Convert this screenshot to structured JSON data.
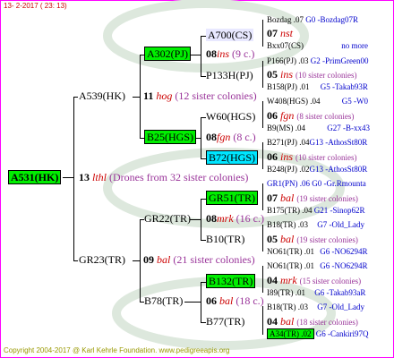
{
  "date": "13-  2-2017  ( 23: 13)",
  "footer": "Copyright 2004-2017 @ Karl Kehrle Foundation.   www.pedigreeapis.org",
  "root": {
    "id": "A531(HK)",
    "gen": "13",
    "mark": "lthl",
    "note": "(Drones from 32 sister colonies)"
  },
  "dam": {
    "id": "A539(HK)",
    "gen": "11",
    "mark": "hog",
    "note": "(12 sister colonies)"
  },
  "sire": {
    "id": "GR23(TR)",
    "gen": "09",
    "mark": "bal",
    "note": "(21 sister colonies)"
  },
  "a302": {
    "id": "A302(PJ)",
    "gen": "08",
    "mark": "ins",
    "note": "(9 c.)"
  },
  "b25": {
    "id": "B25(HGS)",
    "gen": "08",
    "mark": "fgn",
    "note": "(8 c.)"
  },
  "gr22": {
    "id": "GR22(TR)",
    "gen": "08",
    "mark": "mrk",
    "note": "(16 c.)"
  },
  "b78": {
    "id": "B78(TR)",
    "gen": "06",
    "mark": "bal",
    "note": "(18 c.)"
  },
  "a700": {
    "id": "A700(CS)",
    "gen": "07",
    "mark": "nst",
    "top": "Bozdag .07",
    "topr": "G0 -Bozdag07R",
    "bot": "Bxx07(CS)",
    "botr": "no more"
  },
  "p133": {
    "id": "P133H(PJ)",
    "gen": "05",
    "mark": "ins",
    "note": "(10 sister colonies)",
    "top": "P166(PJ) .03",
    "topr": "G2 -PrimGreen00",
    "bot": "B158(PJ) .01",
    "botr": "G5 -Takab93R"
  },
  "w60": {
    "id": "W60(HGS)",
    "gen": "06",
    "mark": "fgn",
    "note": "(8 sister colonies)",
    "top": "W408(HGS) .04",
    "topr": "G5 -W0",
    "bot": "B9(MS) .04",
    "botr": "G27 -B-xx43"
  },
  "b72": {
    "id": "B72(HGS)",
    "gen": "06",
    "mark": "ins",
    "note": "(10 sister colonies)",
    "top": "B271(PJ) .04",
    "topr": "G13 -AthosSt80R",
    "bot": "B248(PJ) .02",
    "botr": "G13 -AthosSt80R"
  },
  "gr51": {
    "id": "GR51(TR)",
    "gen": "07",
    "mark": "bal",
    "note": "(19 sister colonies)",
    "top": "GR1(PN) .06",
    "topr": "G0 -Gr.Rmounta",
    "bot": "B175(TR) .04",
    "botr": "G21 -Sinop62R"
  },
  "b10": {
    "id": "B10(TR)",
    "gen": "05",
    "mark": "bal",
    "note": "(19 sister colonies)",
    "top": "B18(TR) .03",
    "topr": "G7 -Old_Lady",
    "bot": "NO61(TR) .01",
    "botr": "G6 -NO6294R"
  },
  "b132": {
    "id": "B132(TR)",
    "gen": "04",
    "mark": "mrk",
    "note": "(15 sister colonies)",
    "top": "NO61(TR) .01",
    "topr": "G6 -NO6294R",
    "bot": "I89(TR) .01",
    "botr": "G6 -Takab93aR"
  },
  "b77": {
    "id": "B77(TR)",
    "gen": "04",
    "mark": "bal",
    "note": "(18 sister colonies)",
    "top": "B18(TR) .03",
    "topr": "G7 -Old_Lady",
    "bot": "A34(TR) .02",
    "botr": "G6 -Cankiri97Q"
  }
}
